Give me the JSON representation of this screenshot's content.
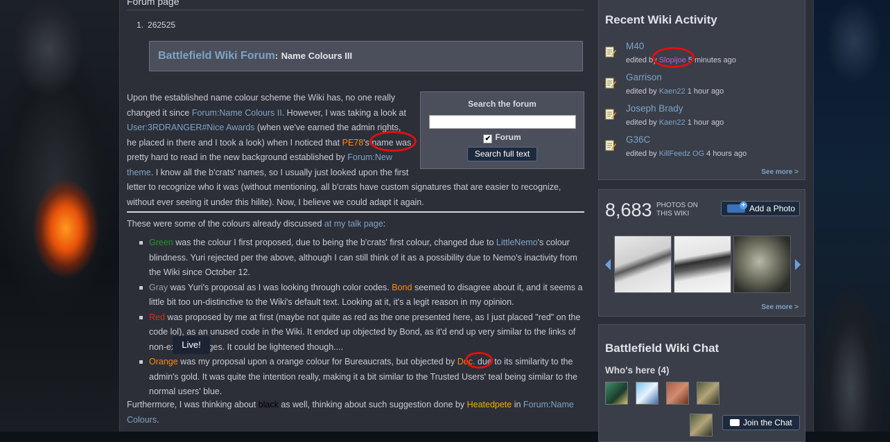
{
  "main": {
    "heading": "Forum page",
    "list_number": "1.",
    "list_value": "262525",
    "forum_box": {
      "link": "Battlefield Wiki Forum",
      "colon": ":",
      "subject": "Name Colours III"
    },
    "search": {
      "title": "Search the forum",
      "input_value": "",
      "checkbox_label": "Forum",
      "checkbox_checked": true,
      "button": "Search full text"
    },
    "p1": {
      "t1": "Upon the established name colour scheme the Wiki has, no one really changed it since ",
      "l1": "Forum:Name Colours II",
      "t2": ". However, I was taking a look at ",
      "l2": "User:3RDRANGER#Nice Awards",
      "t3": " (when we've earned the admin rights, he placed in there and I took a look) when I noticed that ",
      "l3": "PE78",
      "t4": "'s name was pretty hard to read in the new background established by ",
      "l4": "Forum:New theme",
      "t5": ". I know all the b'crats' names, so I usually just looked upon the first letter to recognize who it was (without mentioning, all b'crats have custom signatures that are easier to recognize, without ever seeing it under this hilite). Now, I believe we could adapt it again."
    },
    "p2": {
      "t1": "These were some of the colours already discussed ",
      "l1": "at my talk page",
      "t2": ":"
    },
    "bullets": [
      {
        "c": "Green",
        "t1": " was the colour I first proposed, due to being the b'crats' first colour, changed due to ",
        "l": "LittleNemo",
        "t2": "'s colour blindness. Yuri rejected per the above, although I can still think of it as a possibility due to Nemo's inactivity from the Wiki since October 12."
      },
      {
        "c": "Gray",
        "t1": " was Yuri's proposal as I was looking through color codes. ",
        "l": "Bond",
        "t2": " seemed to disagree about it, and it seems a little bit too un-distinctive to the Wiki's default text. Looking at it, it's a legit reason in my opinion."
      },
      {
        "c": "Red",
        "t1": " was proposed by me at first (maybe not quite as red as the one presented here, as I just placed \"red\" on the code lol), as an unused code in the Wiki. It ended up objected by Bond, as it'd end up very similar to the links of non-existent pages. It could be lightened though....",
        "l": "",
        "t2": ""
      },
      {
        "c": "Orange",
        "t1": " was my proposal upon a orange colour for Bureaucrats, but objected by ",
        "l": "Doc.",
        "t2": " due to its similarity to the admin's gold. It was quite the intention really, making it a bit similar to the Trusted Users' teal being similar to the normal users' blue."
      }
    ],
    "p3": {
      "t1": "Furthermore, I was thinking about ",
      "black": "black",
      "t2": " as well, thinking about such suggestion done by ",
      "l1": "Heatedpete",
      "t3": " in ",
      "l2": "Forum:Name Colours",
      "t4": "."
    }
  },
  "rail": {
    "activity": {
      "title": "Recent Wiki Activity",
      "items": [
        {
          "title": "M40",
          "pre": "edited by ",
          "user": "Slopijoe",
          "post": " 5 minutes ago"
        },
        {
          "title": "Garrison",
          "pre": "edited by ",
          "user": "Kaen22",
          "post": " 1 hour ago"
        },
        {
          "title": "Joseph Brady",
          "pre": "edited by ",
          "user": "Kaen22",
          "post": " 1 hour ago"
        },
        {
          "title": "G36C",
          "pre": "edited by ",
          "user": "KillFeedz OG",
          "post": " 4 hours ago"
        }
      ],
      "see_more": "See more >"
    },
    "photos": {
      "count": "8,683",
      "label": "PHOTOS ON THIS WIKI",
      "add_button": "Add a Photo",
      "see_more": "See more >"
    },
    "chat": {
      "title": "Battlefield Wiki Chat",
      "live": "Live!",
      "whos_here": "Who's here (4)",
      "join_button": "Join the Chat"
    }
  },
  "colors": {
    "link": "#7ea3c4",
    "highlight_circle": "#e11010",
    "green": "#1f9a1f",
    "gray": "#9a9ca2",
    "red": "#e0281c",
    "orange": "#ff8a14",
    "gold": "#f0b000",
    "purple": "#c45fd0"
  }
}
